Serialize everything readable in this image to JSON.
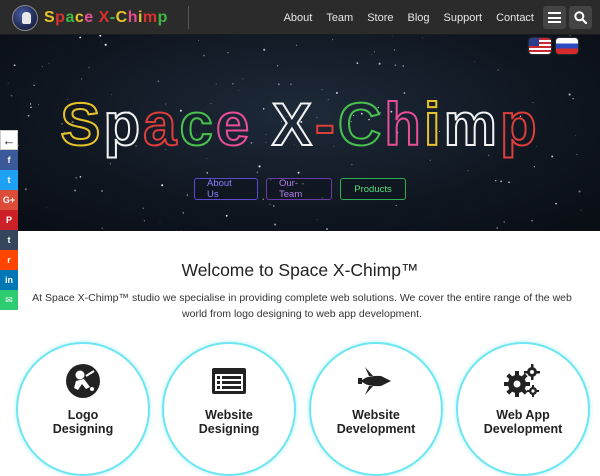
{
  "header": {
    "logo_text": "Space X-Chimp",
    "nav": [
      "About",
      "Team",
      "Store",
      "Blog",
      "Support",
      "Contact"
    ],
    "menu_icon": "hamburger-icon",
    "search_icon": "search-icon"
  },
  "hero": {
    "title": "Space X-Chimp",
    "flags": [
      "us-flag-icon",
      "russia-flag-icon"
    ],
    "buttons": {
      "about": "About Us",
      "team": "Our-Team",
      "products": "Products"
    }
  },
  "social": {
    "toggle": "←",
    "items": [
      {
        "icon": "facebook-icon",
        "glyph": "f"
      },
      {
        "icon": "twitter-icon",
        "glyph": "t"
      },
      {
        "icon": "google-plus-icon",
        "glyph": "G+"
      },
      {
        "icon": "pinterest-icon",
        "glyph": "P"
      },
      {
        "icon": "tumblr-icon",
        "glyph": "t"
      },
      {
        "icon": "reddit-icon",
        "glyph": "r"
      },
      {
        "icon": "linkedin-icon",
        "glyph": "in"
      },
      {
        "icon": "email-icon",
        "glyph": "✉"
      }
    ]
  },
  "welcome": {
    "title": "Welcome to Space X-Chimp™",
    "text": "At Space X-Chimp™ studio we specialise in providing complete web solutions. We cover the entire range of the web world from logo designing to web app development."
  },
  "services": [
    {
      "line1": "Logo",
      "line2": "Designing",
      "icon": "astronaut-icon"
    },
    {
      "line1": "Website",
      "line2": "Designing",
      "icon": "browser-window-icon"
    },
    {
      "line1": "Website",
      "line2": "Development",
      "icon": "space-shuttle-icon"
    },
    {
      "line1": "Web App",
      "line2": "Development",
      "icon": "gears-icon"
    }
  ],
  "colors": {
    "nav_bg": "#2b2b2b",
    "accent_cyan": "#6ee6f2",
    "about_btn": "#5c4bd0",
    "team_btn": "#6a3aa8",
    "products_btn": "#2fae52"
  }
}
